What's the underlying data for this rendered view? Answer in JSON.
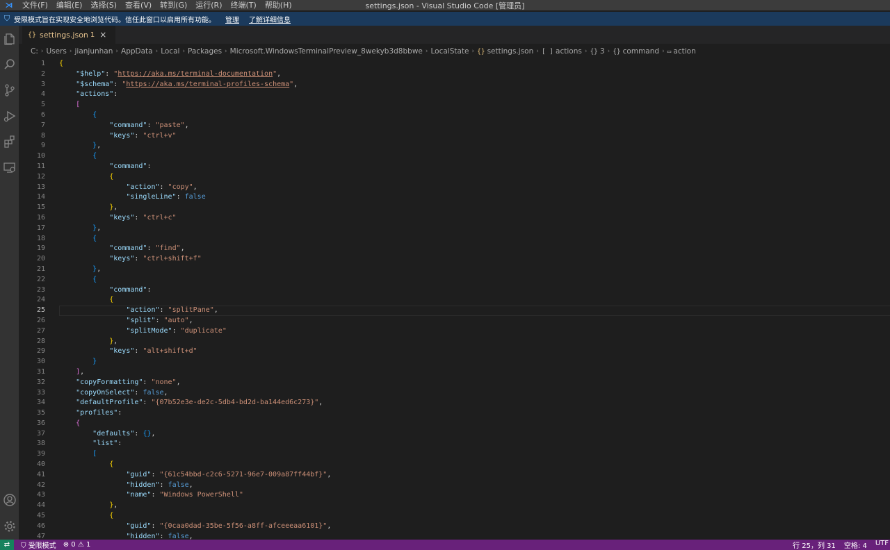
{
  "window": {
    "title": "settings.json - Visual Studio Code [管理员]",
    "menu": [
      "文件(F)",
      "编辑(E)",
      "选择(S)",
      "查看(V)",
      "转到(G)",
      "运行(R)",
      "终端(T)",
      "帮助(H)"
    ]
  },
  "banner": {
    "message": "受限模式旨在实现安全地浏览代码。信任此窗口以启用所有功能。",
    "manage_link": "管理",
    "learn_link": "了解详细信息"
  },
  "activity_bar": [
    "explorer-icon",
    "search-icon",
    "source-control-icon",
    "run-debug-icon",
    "extensions-icon",
    "remote-explorer-icon",
    "account-icon",
    "settings-gear-icon"
  ],
  "tab": {
    "icon": "{}",
    "filename": "settings.json",
    "badge": "1",
    "close": "×"
  },
  "breadcrumb": {
    "path": [
      "C:",
      "Users",
      "jianjunhan",
      "AppData",
      "Local",
      "Packages",
      "Microsoft.WindowsTerminalPreview_8wekyb3d8bbwe",
      "LocalState"
    ],
    "file": "settings.json",
    "symbols": [
      {
        "icon": "[ ]",
        "label": "actions"
      },
      {
        "icon": "{}",
        "label": "3"
      },
      {
        "icon": "{}",
        "label": "command"
      },
      {
        "icon": "▭",
        "label": "action"
      }
    ]
  },
  "editor": {
    "active_line": 25,
    "lines": [
      {
        "n": "1",
        "text": "{"
      },
      {
        "n": "2",
        "text": "    \"$help\": \"https://aka.ms/terminal-documentation\","
      },
      {
        "n": "3",
        "text": "    \"$schema\": \"https://aka.ms/terminal-profiles-schema\","
      },
      {
        "n": "4",
        "text": "    \"actions\":"
      },
      {
        "n": "5",
        "text": "    ["
      },
      {
        "n": "6",
        "text": "        {"
      },
      {
        "n": "7",
        "text": "            \"command\": \"paste\","
      },
      {
        "n": "8",
        "text": "            \"keys\": \"ctrl+v\""
      },
      {
        "n": "9",
        "text": "        },"
      },
      {
        "n": "10",
        "text": "        {"
      },
      {
        "n": "11",
        "text": "            \"command\":"
      },
      {
        "n": "12",
        "text": "            {"
      },
      {
        "n": "13",
        "text": "                \"action\": \"copy\","
      },
      {
        "n": "14",
        "text": "                \"singleLine\": false"
      },
      {
        "n": "15",
        "text": "            },"
      },
      {
        "n": "16",
        "text": "            \"keys\": \"ctrl+c\""
      },
      {
        "n": "17",
        "text": "        },"
      },
      {
        "n": "18",
        "text": "        {"
      },
      {
        "n": "19",
        "text": "            \"command\": \"find\","
      },
      {
        "n": "20",
        "text": "            \"keys\": \"ctrl+shift+f\""
      },
      {
        "n": "21",
        "text": "        },"
      },
      {
        "n": "22",
        "text": "        {"
      },
      {
        "n": "23",
        "text": "            \"command\":"
      },
      {
        "n": "24",
        "text": "            {"
      },
      {
        "n": "25",
        "text": "                \"action\": \"splitPane\","
      },
      {
        "n": "26",
        "text": "                \"split\": \"auto\","
      },
      {
        "n": "27",
        "text": "                \"splitMode\": \"duplicate\""
      },
      {
        "n": "28",
        "text": "            },"
      },
      {
        "n": "29",
        "text": "            \"keys\": \"alt+shift+d\""
      },
      {
        "n": "30",
        "text": "        }"
      },
      {
        "n": "31",
        "text": "    ],"
      },
      {
        "n": "32",
        "text": "    \"copyFormatting\": \"none\","
      },
      {
        "n": "33",
        "text": "    \"copyOnSelect\": false,"
      },
      {
        "n": "34",
        "text": "    \"defaultProfile\": \"{07b52e3e-de2c-5db4-bd2d-ba144ed6c273}\","
      },
      {
        "n": "35",
        "text": "    \"profiles\":"
      },
      {
        "n": "36",
        "text": "    {"
      },
      {
        "n": "37",
        "text": "        \"defaults\": {},"
      },
      {
        "n": "38",
        "text": "        \"list\":"
      },
      {
        "n": "39",
        "text": "        ["
      },
      {
        "n": "40",
        "text": "            {"
      },
      {
        "n": "41",
        "text": "                \"guid\": \"{61c54bbd-c2c6-5271-96e7-009a87ff44bf}\","
      },
      {
        "n": "42",
        "text": "                \"hidden\": false,"
      },
      {
        "n": "43",
        "text": "                \"name\": \"Windows PowerShell\""
      },
      {
        "n": "44",
        "text": "            },"
      },
      {
        "n": "45",
        "text": "            {"
      },
      {
        "n": "46",
        "text": "                \"guid\": \"{0caa0dad-35be-5f56-a8ff-afceeeaa6101}\","
      },
      {
        "n": "47",
        "text": "                \"hidden\": false,"
      }
    ]
  },
  "status_bar": {
    "remote_icon": "remote-icon",
    "restricted_mode": "受限模式",
    "errors": "0",
    "warnings": "1",
    "cursor": "行 25，列 31",
    "spaces": "空格: 4",
    "encoding": "UTF"
  },
  "colors": {
    "key": "#9cdcfe",
    "string": "#ce9178",
    "boolean": "#569cd6",
    "bracket_gold": "#ffd700",
    "bracket_purple": "#da70d6",
    "bracket_blue": "#179fff",
    "status_bar": "#68217a"
  }
}
